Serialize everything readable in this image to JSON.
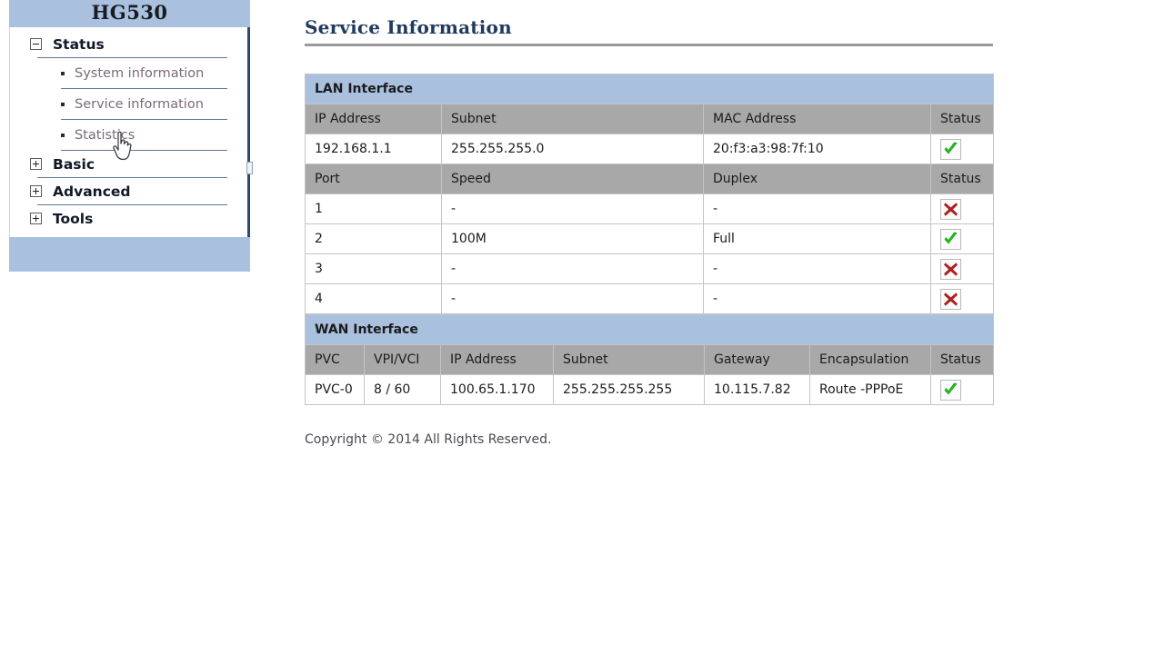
{
  "sidebar": {
    "brand": "HG530",
    "groups": [
      {
        "label": "Status",
        "icon": "minus-box-icon",
        "expanded": true,
        "items": [
          {
            "label": "System information"
          },
          {
            "label": "Service information"
          },
          {
            "label": "Statistics"
          }
        ]
      },
      {
        "label": "Basic",
        "icon": "plus-box-icon",
        "expanded": false,
        "items": []
      },
      {
        "label": "Advanced",
        "icon": "plus-box-icon",
        "expanded": false,
        "items": []
      },
      {
        "label": "Tools",
        "icon": "plus-box-icon",
        "expanded": false,
        "items": []
      }
    ]
  },
  "main": {
    "title": "Service Information",
    "lan": {
      "section_label": "LAN Interface",
      "ip_headers": [
        "IP Address",
        "Subnet",
        "MAC Address",
        "Status"
      ],
      "ip_row": {
        "ip_address": "192.168.1.1",
        "subnet": "255.255.255.0",
        "mac_address": "20:f3:a3:98:7f:10",
        "status": "ok"
      },
      "port_headers": [
        "Port",
        "Speed",
        "Duplex",
        "Status"
      ],
      "port_rows": [
        {
          "port": "1",
          "speed": "-",
          "duplex": "-",
          "status": "fail"
        },
        {
          "port": "2",
          "speed": "100M",
          "duplex": "Full",
          "status": "ok"
        },
        {
          "port": "3",
          "speed": "-",
          "duplex": "-",
          "status": "fail"
        },
        {
          "port": "4",
          "speed": "-",
          "duplex": "-",
          "status": "fail"
        }
      ]
    },
    "wan": {
      "section_label": "WAN Interface",
      "headers": [
        "PVC",
        "VPI/VCI",
        "IP Address",
        "Subnet",
        "Gateway",
        "Encapsulation",
        "Status"
      ],
      "rows": [
        {
          "pvc": "PVC-0",
          "vpi_vci": "8 / 60",
          "ip_address": "100.65.1.170",
          "subnet": "255.255.255.255",
          "gateway": "10.115.7.82",
          "encapsulation": "Route -PPPoE",
          "status": "ok"
        }
      ]
    },
    "footer": "Copyright © 2014 All Rights Reserved."
  },
  "colors": {
    "panel_blue": "#a9c0de",
    "header_grey": "#a8a8a8",
    "title_navy": "#1f3a5f",
    "status_ok": "#22c022",
    "status_fail": "#b02020",
    "link_purple": "#7b6a79"
  },
  "cursor": {
    "type": "pointer-hand-cursor"
  }
}
